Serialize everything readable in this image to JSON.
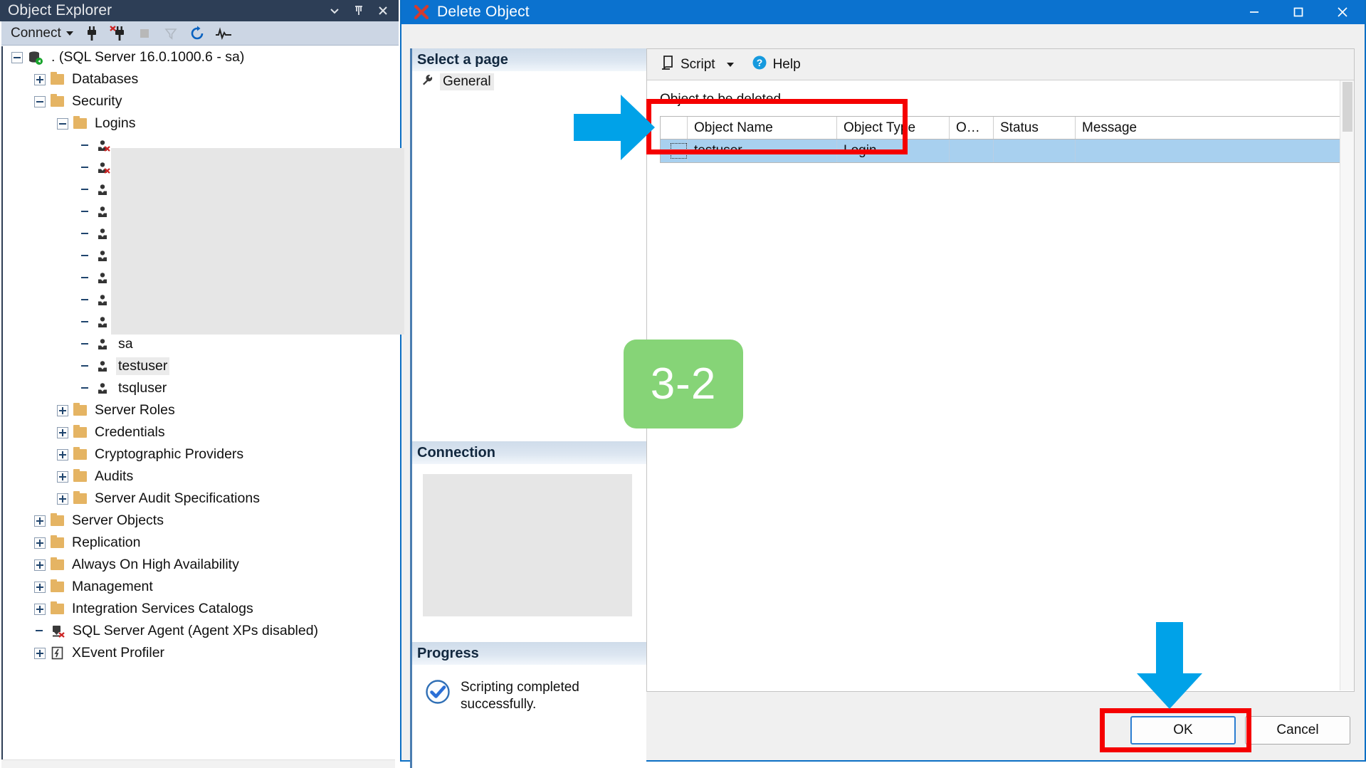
{
  "object_explorer": {
    "title": "Object Explorer",
    "titlebar_buttons": [
      {
        "name": "dropdown-icon",
        "glyph": "▾"
      },
      {
        "name": "pin-icon",
        "glyph": "╤"
      },
      {
        "name": "close-icon",
        "glyph": "✕"
      }
    ],
    "toolbar": {
      "connect_label": "Connect",
      "tools": [
        {
          "name": "connect-icon",
          "title": "Connect"
        },
        {
          "name": "disconnect-icon",
          "title": "Disconnect"
        },
        {
          "name": "stop-icon",
          "title": "Stop",
          "disabled": true
        },
        {
          "name": "filter-icon",
          "title": "Filter",
          "disabled": true
        },
        {
          "name": "refresh-icon",
          "title": "Refresh"
        },
        {
          "name": "activity-monitor-icon",
          "title": "Activity Monitor"
        }
      ]
    },
    "tree": [
      {
        "label": ". (SQL Server 16.0.1000.6 - sa)",
        "indent": 0,
        "expander": "minus",
        "icon": "server-icon"
      },
      {
        "label": "Databases",
        "indent": 1,
        "expander": "plus",
        "icon": "folder-icon"
      },
      {
        "label": "Security",
        "indent": 1,
        "expander": "minus",
        "icon": "folder-icon"
      },
      {
        "label": "Logins",
        "indent": 2,
        "expander": "minus",
        "icon": "folder-icon"
      },
      {
        "label": "",
        "indent": 3,
        "expander": "none",
        "icon": "login-disabled-icon",
        "redacted": true
      },
      {
        "label": "",
        "indent": 3,
        "expander": "none",
        "icon": "login-disabled-icon",
        "redacted": true
      },
      {
        "label": "",
        "indent": 3,
        "expander": "none",
        "icon": "login-icon",
        "redacted": true
      },
      {
        "label": "",
        "indent": 3,
        "expander": "none",
        "icon": "login-icon",
        "redacted": true
      },
      {
        "label": "",
        "indent": 3,
        "expander": "none",
        "icon": "login-icon",
        "redacted": true
      },
      {
        "label": "",
        "indent": 3,
        "expander": "none",
        "icon": "login-icon",
        "redacted": true
      },
      {
        "label": "",
        "indent": 3,
        "expander": "none",
        "icon": "login-icon",
        "redacted": true
      },
      {
        "label": "",
        "indent": 3,
        "expander": "none",
        "icon": "login-icon",
        "redacted": true
      },
      {
        "label": "",
        "indent": 3,
        "expander": "none",
        "icon": "login-icon",
        "redacted": true
      },
      {
        "label": "sa",
        "indent": 3,
        "expander": "none",
        "icon": "login-icon"
      },
      {
        "label": "testuser",
        "indent": 3,
        "expander": "none",
        "icon": "login-icon",
        "selected": true
      },
      {
        "label": "tsqluser",
        "indent": 3,
        "expander": "none",
        "icon": "login-icon"
      },
      {
        "label": "Server Roles",
        "indent": 2,
        "expander": "plus",
        "icon": "folder-icon"
      },
      {
        "label": "Credentials",
        "indent": 2,
        "expander": "plus",
        "icon": "folder-icon"
      },
      {
        "label": "Cryptographic Providers",
        "indent": 2,
        "expander": "plus",
        "icon": "folder-icon"
      },
      {
        "label": "Audits",
        "indent": 2,
        "expander": "plus",
        "icon": "folder-icon"
      },
      {
        "label": "Server Audit Specifications",
        "indent": 2,
        "expander": "plus",
        "icon": "folder-icon"
      },
      {
        "label": "Server Objects",
        "indent": 1,
        "expander": "plus",
        "icon": "folder-icon"
      },
      {
        "label": "Replication",
        "indent": 1,
        "expander": "plus",
        "icon": "folder-icon"
      },
      {
        "label": "Always On High Availability",
        "indent": 1,
        "expander": "plus",
        "icon": "folder-icon"
      },
      {
        "label": "Management",
        "indent": 1,
        "expander": "plus",
        "icon": "folder-icon"
      },
      {
        "label": "Integration Services Catalogs",
        "indent": 1,
        "expander": "plus",
        "icon": "folder-icon"
      },
      {
        "label": "SQL Server Agent (Agent XPs disabled)",
        "indent": 1,
        "expander": "none",
        "icon": "agent-disabled-icon"
      },
      {
        "label": "XEvent Profiler",
        "indent": 1,
        "expander": "plus",
        "icon": "xevent-icon"
      }
    ]
  },
  "dialog": {
    "title": "Delete Object",
    "window_buttons": [
      {
        "name": "minimize-button",
        "glyph": "—"
      },
      {
        "name": "maximize-button",
        "glyph": "□"
      },
      {
        "name": "close-button",
        "glyph": "✕"
      }
    ],
    "select_page": {
      "heading": "Select a page",
      "items": [
        {
          "label": "General",
          "icon": "wrench-icon",
          "selected": true
        }
      ]
    },
    "connection": {
      "heading": "Connection",
      "body_redacted": true
    },
    "progress": {
      "heading": "Progress",
      "status_icon": "success-check-icon",
      "status_text": "Scripting completed successfully."
    },
    "toolbar": {
      "script_label": "Script",
      "script_icon": "script-icon",
      "script_caret": "▾",
      "help_label": "Help",
      "help_icon": "help-icon"
    },
    "grid": {
      "section_label": "Object to be deleted",
      "columns": [
        "Object Name",
        "Object Type",
        "O…",
        "Status",
        "Message"
      ],
      "rows": [
        {
          "object_name": "testuser",
          "object_type": "Login",
          "owner": "",
          "status": "",
          "message": "",
          "selected": true
        }
      ]
    },
    "buttons": {
      "ok_label": "OK",
      "cancel_label": "Cancel"
    }
  },
  "annotations": {
    "step_badge": "3-2",
    "badge_color": "#86d477",
    "highlight_color": "#f50000",
    "arrow_color": "#00a2e8",
    "items": [
      {
        "name": "grid-highlight-box",
        "kind": "rect"
      },
      {
        "name": "ok-button-highlight-box",
        "kind": "rect"
      },
      {
        "name": "grid-pointer-arrow",
        "kind": "arrow-right"
      },
      {
        "name": "ok-pointer-arrow",
        "kind": "arrow-down"
      }
    ]
  }
}
